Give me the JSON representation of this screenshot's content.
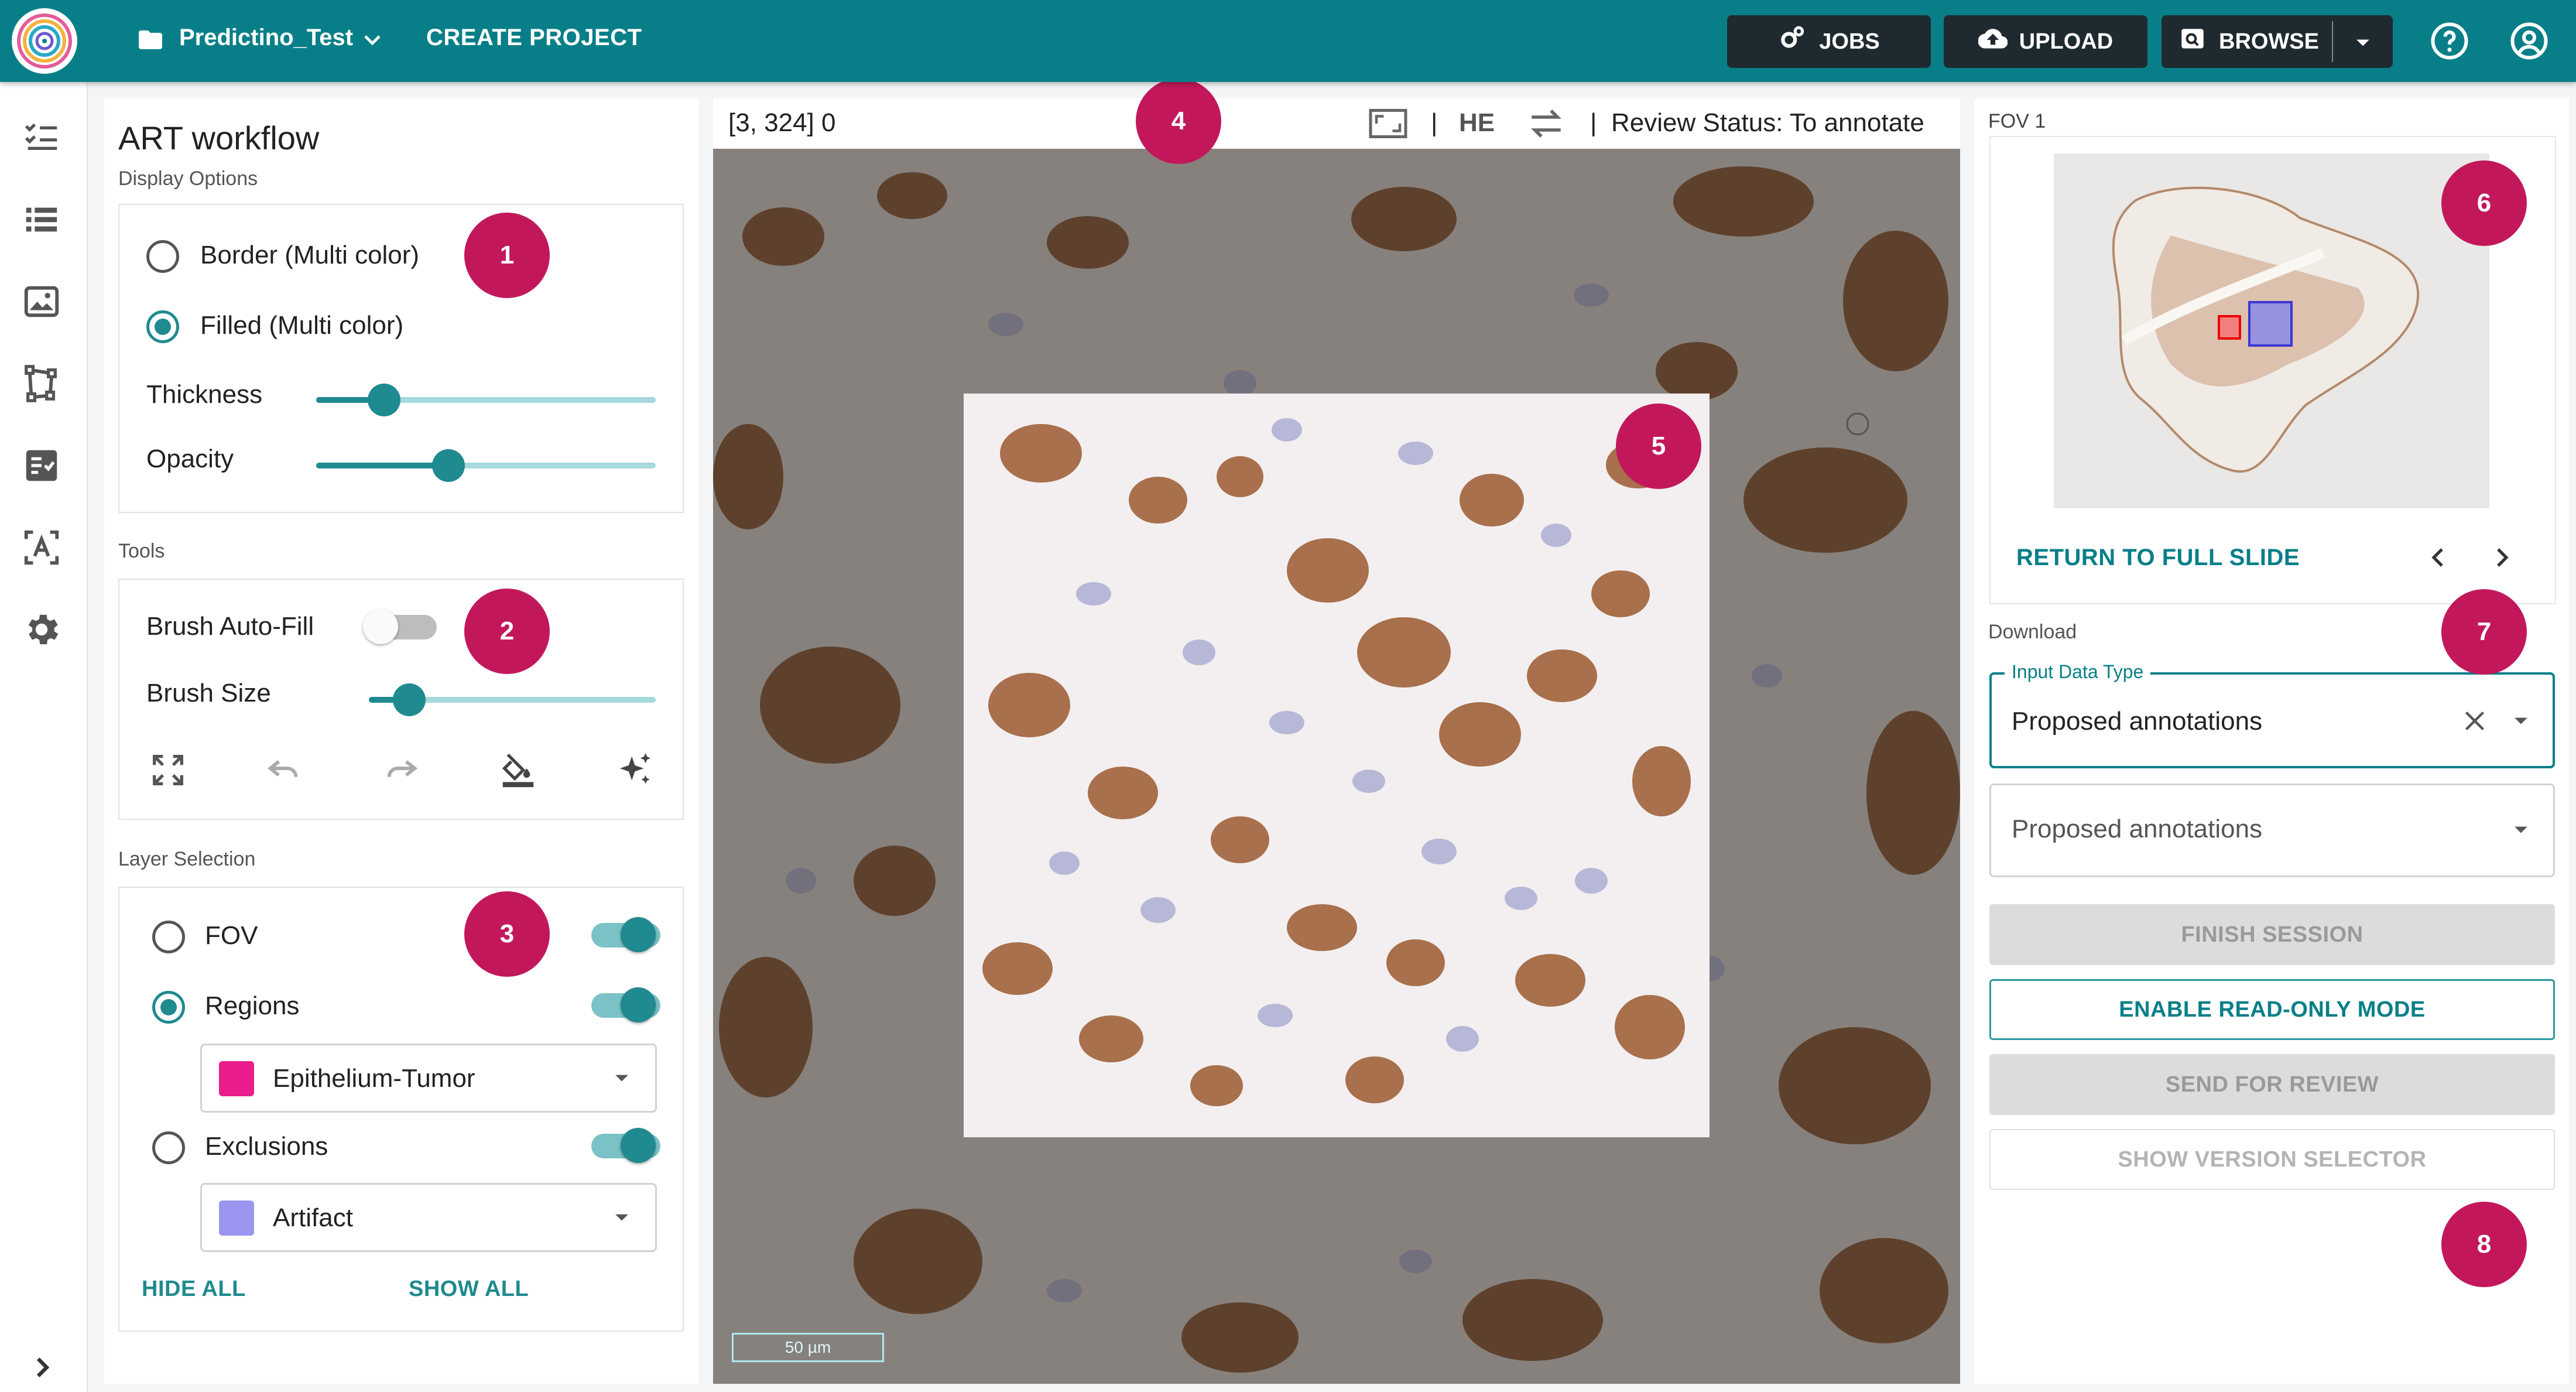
{
  "header": {
    "project_name": "Predictino_Test",
    "create_project_label": "CREATE PROJECT",
    "buttons": {
      "jobs": "JOBS",
      "upload": "UPLOAD",
      "browse": "BROWSE"
    },
    "icons": [
      "app-logo",
      "folder-icon",
      "chevron-down-icon",
      "gears-icon",
      "cloud-upload-icon",
      "browse-icon",
      "help-icon",
      "account-icon"
    ],
    "accent_color": "#087f88"
  },
  "rail": {
    "icons": [
      "checklist-icon",
      "list-icon",
      "image-icon",
      "polygon-icon",
      "task-icon",
      "text-recognition-icon",
      "settings-icon",
      "expand-chevron-icon"
    ]
  },
  "left_panel": {
    "title": "ART workflow",
    "display_options": {
      "label": "Display Options",
      "options": [
        "Border (Multi color)",
        "Filled (Multi color)"
      ],
      "selected": "Filled (Multi color)",
      "thickness_label": "Thickness",
      "thickness_value": 0.2,
      "opacity_label": "Opacity",
      "opacity_value": 0.39
    },
    "tools": {
      "label": "Tools",
      "brush_autofill_label": "Brush Auto-Fill",
      "brush_autofill_on": false,
      "brush_size_label": "Brush Size",
      "brush_size_value": 0.14,
      "icons": [
        "fullscreen-icon",
        "undo-icon",
        "redo-icon",
        "fill-bucket-icon",
        "magic-sparkle-icon"
      ]
    },
    "layer_selection": {
      "label": "Layer Selection",
      "layers": [
        {
          "name": "FOV",
          "selected": false,
          "visible": true
        },
        {
          "name": "Regions",
          "selected": true,
          "visible": true,
          "class_name": "Epithelium-Tumor",
          "class_color": "#e91e8c"
        },
        {
          "name": "Exclusions",
          "selected": false,
          "visible": true,
          "class_name": "Artifact",
          "class_color": "#9b95f0"
        }
      ],
      "hide_all": "HIDE ALL",
      "show_all": "SHOW ALL"
    }
  },
  "viewer": {
    "coords": "[3, 324] 0",
    "stain": "HE",
    "separator": "|",
    "review_status": "Review Status: To annotate",
    "scale_label": "50 µm"
  },
  "right_panel": {
    "fov_label": "FOV 1",
    "return_full_slide": "RETURN TO FULL SLIDE",
    "download_label": "Download",
    "input_data_type_label": "Input Data Type",
    "input_data_type_value": "Proposed annotations",
    "second_select_value": "Proposed annotations",
    "buttons": {
      "finish_session": "FINISH SESSION",
      "read_only": "ENABLE READ-ONLY MODE",
      "send_review": "SEND FOR REVIEW",
      "version_selector": "SHOW VERSION SELECTOR"
    }
  },
  "callouts": [
    "1",
    "2",
    "3",
    "4",
    "5",
    "6",
    "7",
    "8"
  ],
  "callout_color": "#c2185b"
}
